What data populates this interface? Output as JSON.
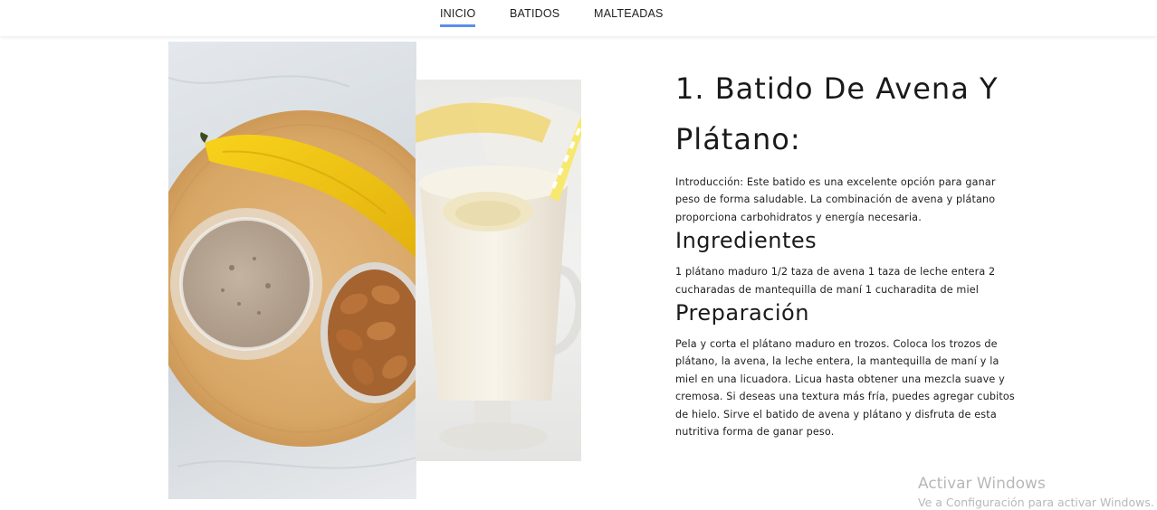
{
  "nav": {
    "items": [
      {
        "label": "INICIO",
        "active": true
      },
      {
        "label": "BATIDOS",
        "active": false
      },
      {
        "label": "MALTEADAS",
        "active": false
      }
    ],
    "active_underline_color": "#5b8def"
  },
  "images": {
    "left": "banana-oat-smoothie-bowl-with-almonds",
    "right": "glass-of-banana-milkshake-with-straw"
  },
  "recipe": {
    "title_line1": "1. Batido De Avena Y",
    "title_line2": "Plátano:",
    "intro": "Introducción: Este batido es una excelente opción para ganar peso de forma saludable. La combinación de avena y plátano proporciona carbohidratos y energía necesaria.",
    "ingredients_heading": "Ingredientes",
    "ingredients_text": "1 plátano maduro 1/2 taza de avena 1 taza de leche entera 2 cucharadas de mantequilla de maní 1 cucharadita de miel",
    "preparation_heading": "Preparación",
    "preparation_text": "Pela y corta el plátano maduro en trozos. Coloca los trozos de plátano, la avena, la leche entera, la mantequilla de maní y la miel en una licuadora. Licua hasta obtener una mezcla suave y cremosa. Si deseas una textura más fría, puedes agregar cubitos de hielo. Sirve el batido de avena y plátano y disfruta de esta nutritiva forma de ganar peso."
  },
  "watermark": {
    "title": "Activar Windows",
    "subtitle": "Ve a Configuración para activar Windows."
  }
}
